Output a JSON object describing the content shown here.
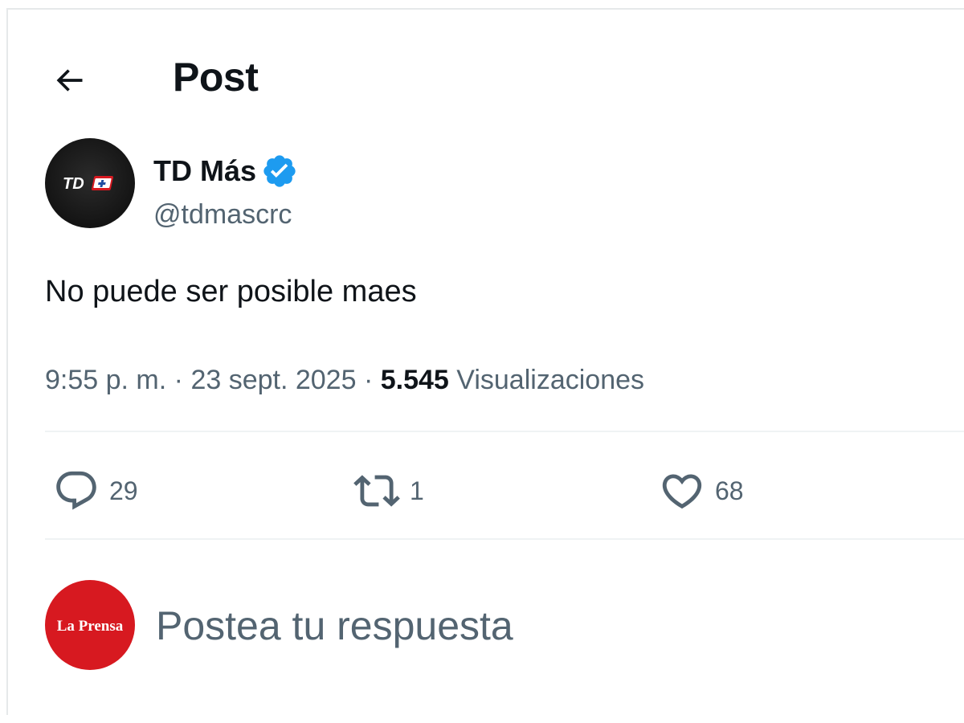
{
  "header": {
    "title": "Post",
    "back_icon": "arrow-left-icon"
  },
  "author": {
    "display_name": "TD Más",
    "handle": "@tdmascrc",
    "verified": true,
    "verified_color": "#1d9bf0",
    "avatar_logo": "TD+"
  },
  "post": {
    "text": "No puede ser posible maes",
    "time": "9:55 p. m.",
    "separator": "·",
    "date": "23 sept. 2025",
    "views_count": "5.545",
    "views_label": "Visualizaciones"
  },
  "actions": {
    "replies": "29",
    "reposts": "1",
    "likes": "68",
    "reply_icon": "speech-bubble-icon",
    "repost_icon": "repost-icon",
    "like_icon": "heart-icon"
  },
  "reply_box": {
    "avatar_label": "La Prensa",
    "avatar_color": "#d71920",
    "placeholder": "Postea tu respuesta"
  },
  "colors": {
    "text": "#0f1419",
    "secondary": "#536471",
    "divider": "#eff3f4"
  }
}
